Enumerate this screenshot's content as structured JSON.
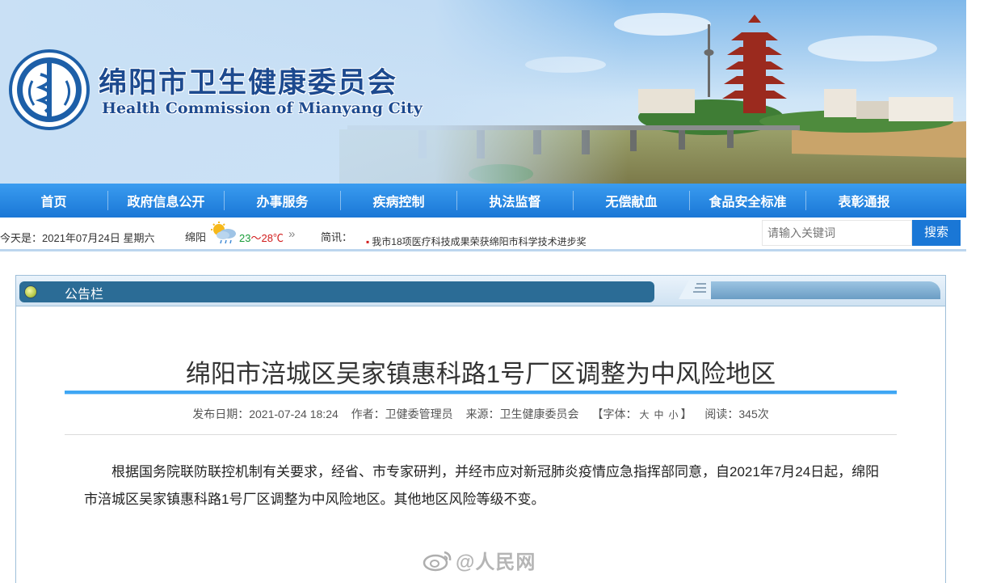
{
  "header": {
    "title_cn": "绵阳市卫生健康委员会",
    "title_en": "Health Commission of Mianyang City"
  },
  "nav": {
    "items": [
      "首页",
      "政府信息公开",
      "办事服务",
      "疾病控制",
      "执法监督",
      "无偿献血",
      "食品安全标准",
      "表彰通报"
    ]
  },
  "infobar": {
    "today": "今天是：2021年07月24日 星期六",
    "city": "绵阳",
    "weather_icon": "partly-cloudy-rain-icon",
    "temp_low": "23",
    "temp_sep": "～",
    "temp_high": "28℃",
    "more": "»",
    "news_label": "简讯：",
    "news_item": "我市18项医疗科技成果荣获绵阳市科学技术进步奖",
    "search_placeholder": "请输入关键词",
    "search_button": "搜索"
  },
  "panel": {
    "title": "公告栏"
  },
  "article": {
    "title": "绵阳市涪城区吴家镇惠科路1号厂区调整为中风险地区",
    "meta": {
      "date": "发布日期：2021-07-24 18:24",
      "author": "作者：卫健委管理员",
      "source": "来源：卫生健康委员会",
      "font_prefix": "【字体：",
      "font_large": "大",
      "font_medium": "中",
      "font_small": "小",
      "font_suffix": "】",
      "reads": "阅读：345次"
    },
    "body": "根据国务院联防联控机制有关要求，经省、市专家研判，并经市应对新冠肺炎疫情应急指挥部同意，自2021年7月24日起，绵阳市涪城区吴家镇惠科路1号厂区调整为中风险地区。其他地区风险等级不变。"
  },
  "watermark": {
    "text": "@人民网"
  },
  "colors": {
    "nav_blue": "#1a77d6",
    "title_blue": "#1d4a8f",
    "panel_tab": "#2b6c96",
    "rule_blue": "#3ea6f4",
    "temp_low": "#1a9c3a",
    "temp_high": "#d11b1b"
  }
}
